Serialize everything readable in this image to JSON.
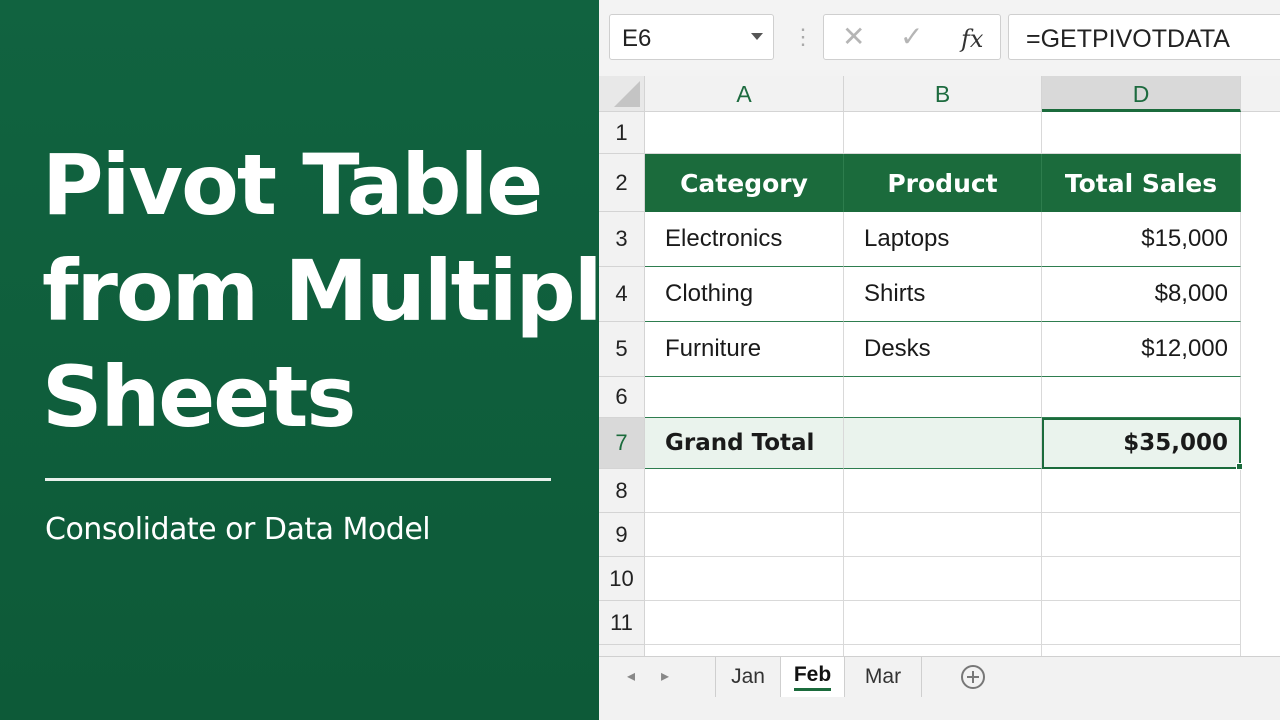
{
  "hero": {
    "title_lines": [
      "Pivot Table",
      "from Multiple",
      "Sheets"
    ],
    "subtitle": "Consolidate or Data Model"
  },
  "formula_bar": {
    "name_box": "E6",
    "formula": "=GETPIVOTDATA",
    "cancel_icon": "✕",
    "enter_icon": "✓",
    "fx_icon": "fx",
    "dots_icon": "⋮"
  },
  "grid": {
    "columns": [
      "A",
      "B",
      "D"
    ],
    "active_column": "D",
    "rows": [
      "1",
      "2",
      "3",
      "4",
      "5",
      "6",
      "7",
      "8",
      "9",
      "10",
      "11"
    ],
    "active_row": "7",
    "table": {
      "headers": [
        "Category",
        "Product",
        "Total Sales"
      ],
      "rows": [
        [
          "Electronics",
          "Laptops",
          "$15,000"
        ],
        [
          "Clothing",
          "Shirts",
          "$8,000"
        ],
        [
          "Furniture",
          "Desks",
          "$12,000"
        ]
      ],
      "total": {
        "label": "Grand Total",
        "value": "$35,000"
      }
    }
  },
  "sheet_tabs": {
    "tabs": [
      "Jan",
      "Feb",
      "Mar"
    ],
    "active": "Feb",
    "prev_icon": "◂",
    "next_icon": "▸"
  },
  "colors": {
    "brand_green": "#1b6b3c",
    "panel_green": "#0f5c3a",
    "total_fill": "#eaf3ed"
  }
}
